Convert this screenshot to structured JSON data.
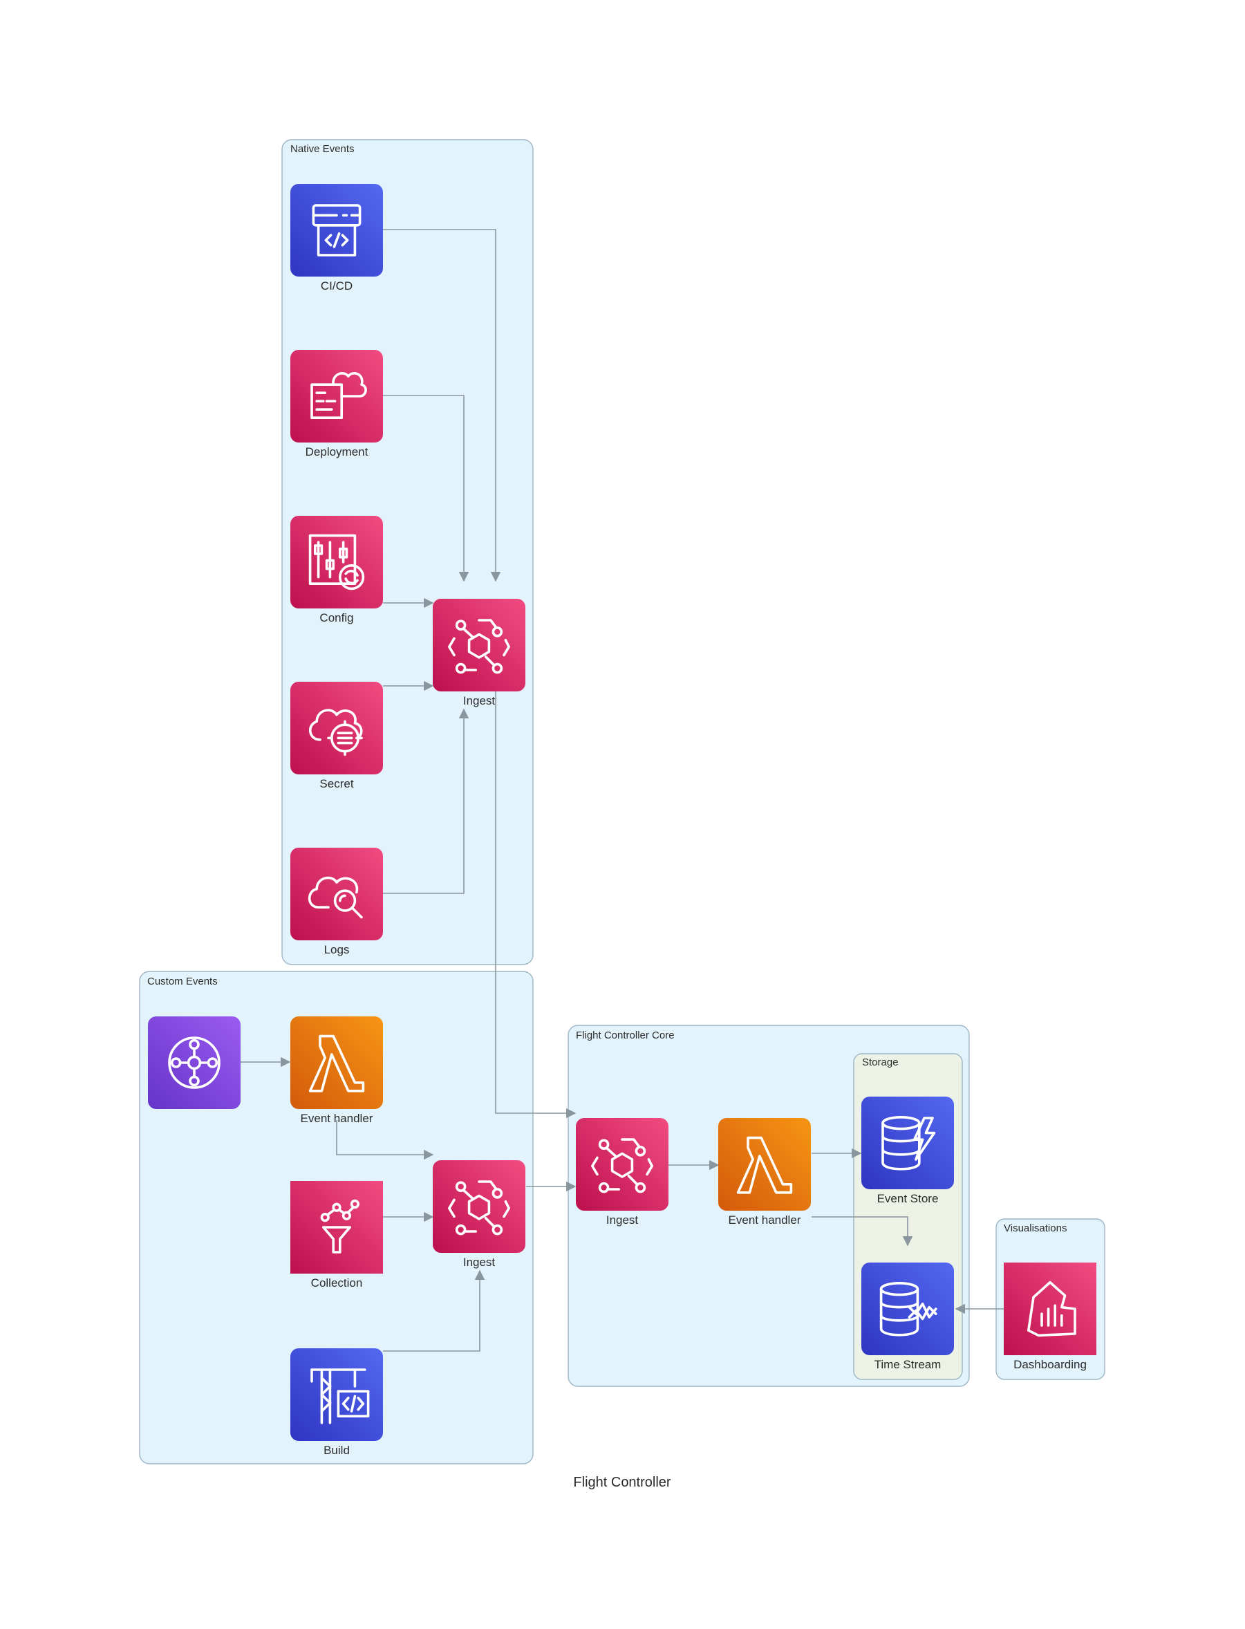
{
  "title": "Flight Controller",
  "colors": {
    "cluster_fill": "#e3f3fb",
    "cluster_stroke": "#9db6c4",
    "storage_fill": "#edf2e6",
    "edge": "#8a969e",
    "pink": "#d6245f",
    "blue": "#3f4fd6",
    "orange": "#ea7711",
    "purple": "#7d45dc"
  },
  "clusters": {
    "native": "Native Events",
    "custom": "Custom Events",
    "core": "Flight Controller Core",
    "storage": "Storage",
    "visual": "Visualisations"
  },
  "nodes": {
    "cicd": {
      "label": "CI/CD",
      "icon": "code-pipeline-icon"
    },
    "deployment": {
      "label": "Deployment",
      "icon": "cloudformation-icon"
    },
    "config": {
      "label": "Config",
      "icon": "config-icon"
    },
    "secret": {
      "label": "Secret",
      "icon": "secrets-manager-icon"
    },
    "logs": {
      "label": "Logs",
      "icon": "cloudwatch-logs-icon"
    },
    "native_ingest": {
      "label": "Ingest",
      "icon": "eventbridge-icon"
    },
    "custom_source": {
      "label": "",
      "icon": "api-hub-icon"
    },
    "custom_handler": {
      "label": "Event handler",
      "icon": "lambda-icon"
    },
    "collection": {
      "label": "Collection",
      "icon": "collection-funnel-icon"
    },
    "custom_ingest": {
      "label": "Ingest",
      "icon": "eventbridge-icon"
    },
    "build": {
      "label": "Build",
      "icon": "code-build-icon"
    },
    "core_ingest": {
      "label": "Ingest",
      "icon": "eventbridge-icon"
    },
    "core_handler": {
      "label": "Event handler",
      "icon": "lambda-icon"
    },
    "event_store": {
      "label": "Event Store",
      "icon": "dynamodb-icon"
    },
    "time_stream": {
      "label": "Time Stream",
      "icon": "timestream-icon"
    },
    "dashboarding": {
      "label": "Dashboarding",
      "icon": "quicksight-icon"
    }
  }
}
